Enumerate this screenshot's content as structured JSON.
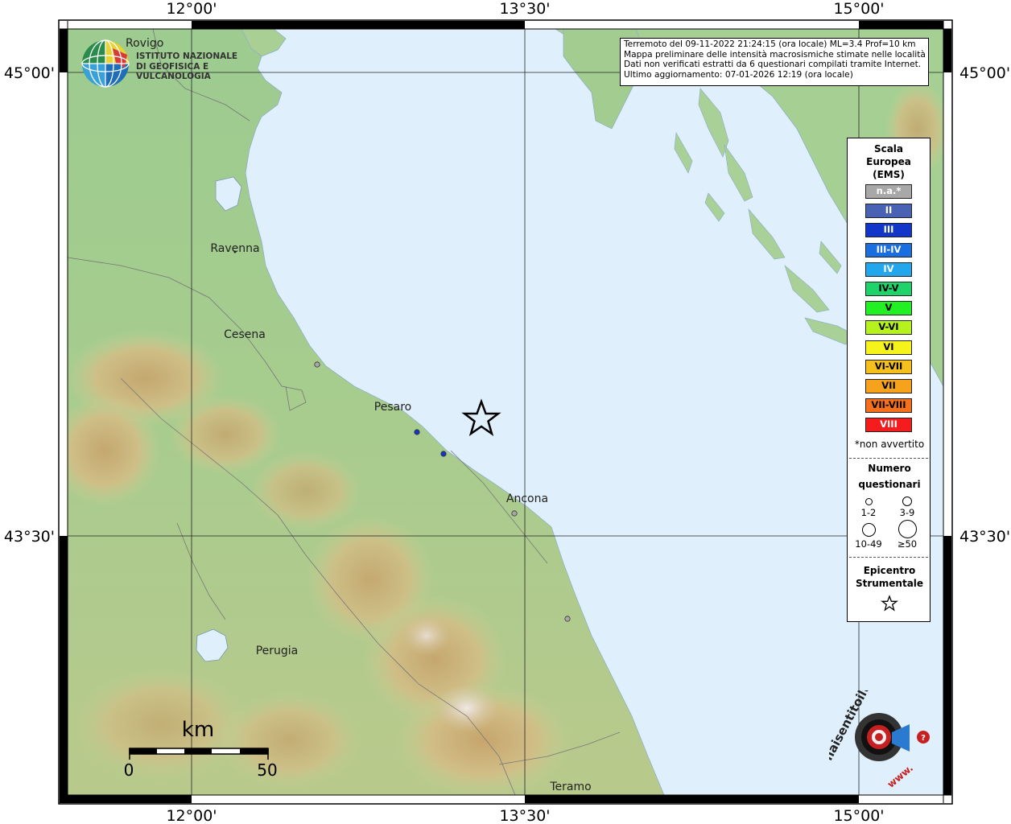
{
  "info": {
    "line1": "Terremoto del 09-11-2022 21:24:15 (ora locale) ML=3.4 Prof=10 km",
    "line2": "Mappa preliminare delle intensità macrosismiche stimate nelle località",
    "line3": "Dati non verificati estratti da 6 questionari compilati tramite Internet.",
    "line4": "Ultimo aggiornamento: 07-01-2026 12:19 (ora locale)"
  },
  "axes": {
    "top_left": "12°00'",
    "top_mid": "13°30'",
    "top_right": "15°00'",
    "bottom_left": "12°00'",
    "bottom_mid": "13°30'",
    "bottom_right": "15°00'",
    "left_upper": "45°00'",
    "left_lower": "43°30'",
    "right_upper": "45°00'",
    "right_lower": "43°30'"
  },
  "cities": {
    "rovigo": "Rovigo",
    "ravenna": "Ravenna",
    "cesena": "Cesena",
    "pesaro": "Pesaro",
    "ancona": "Ancona",
    "perugia": "Perugia",
    "teramo": "Teramo"
  },
  "scale_bar": {
    "unit": "km",
    "start": "0",
    "end": "50"
  },
  "logo_ingv": {
    "line1": "ISTITUTO NAZIONALE",
    "line2": "DI GEOFISICA E VULCANOLOGIA"
  },
  "logo_hst": {
    "text": "haisentitoilterremoto.it",
    "www": "www."
  },
  "legend": {
    "title1": "Scala",
    "title2": "Europea",
    "title3": "(EMS)",
    "items": [
      {
        "label": "n.a.*",
        "color": "#a8a8a8",
        "text_color": "#ffffff"
      },
      {
        "label": "II",
        "color": "#4a62b4",
        "text_color": "#ffffff"
      },
      {
        "label": "III",
        "color": "#1236c8",
        "text_color": "#ffffff"
      },
      {
        "label": "III-IV",
        "color": "#1a6ee0",
        "text_color": "#ffffff"
      },
      {
        "label": "IV",
        "color": "#22a6ec",
        "text_color": "#ffffff"
      },
      {
        "label": "IV-V",
        "color": "#1ed36a",
        "text_color": "#000000"
      },
      {
        "label": "V",
        "color": "#22f022",
        "text_color": "#000000"
      },
      {
        "label": "V-VI",
        "color": "#b6f21c",
        "text_color": "#000000"
      },
      {
        "label": "VI",
        "color": "#f6f21c",
        "text_color": "#000000"
      },
      {
        "label": "VI-VII",
        "color": "#f6c01c",
        "text_color": "#000000"
      },
      {
        "label": "VII",
        "color": "#f6a21c",
        "text_color": "#000000"
      },
      {
        "label": "VII-VIII",
        "color": "#f6701c",
        "text_color": "#000000"
      },
      {
        "label": "VIII",
        "color": "#f41c1c",
        "text_color": "#ffffff"
      }
    ],
    "note": "*non avvertito",
    "count_title1": "Numero",
    "count_title2": "questionari",
    "counts": [
      "1-2",
      "3-9",
      "10-49",
      "≥50"
    ],
    "epi_title1": "Epicentro",
    "epi_title2": "Strumentale"
  },
  "colors": {
    "sea": "#dff0fc",
    "border": "#000000"
  }
}
